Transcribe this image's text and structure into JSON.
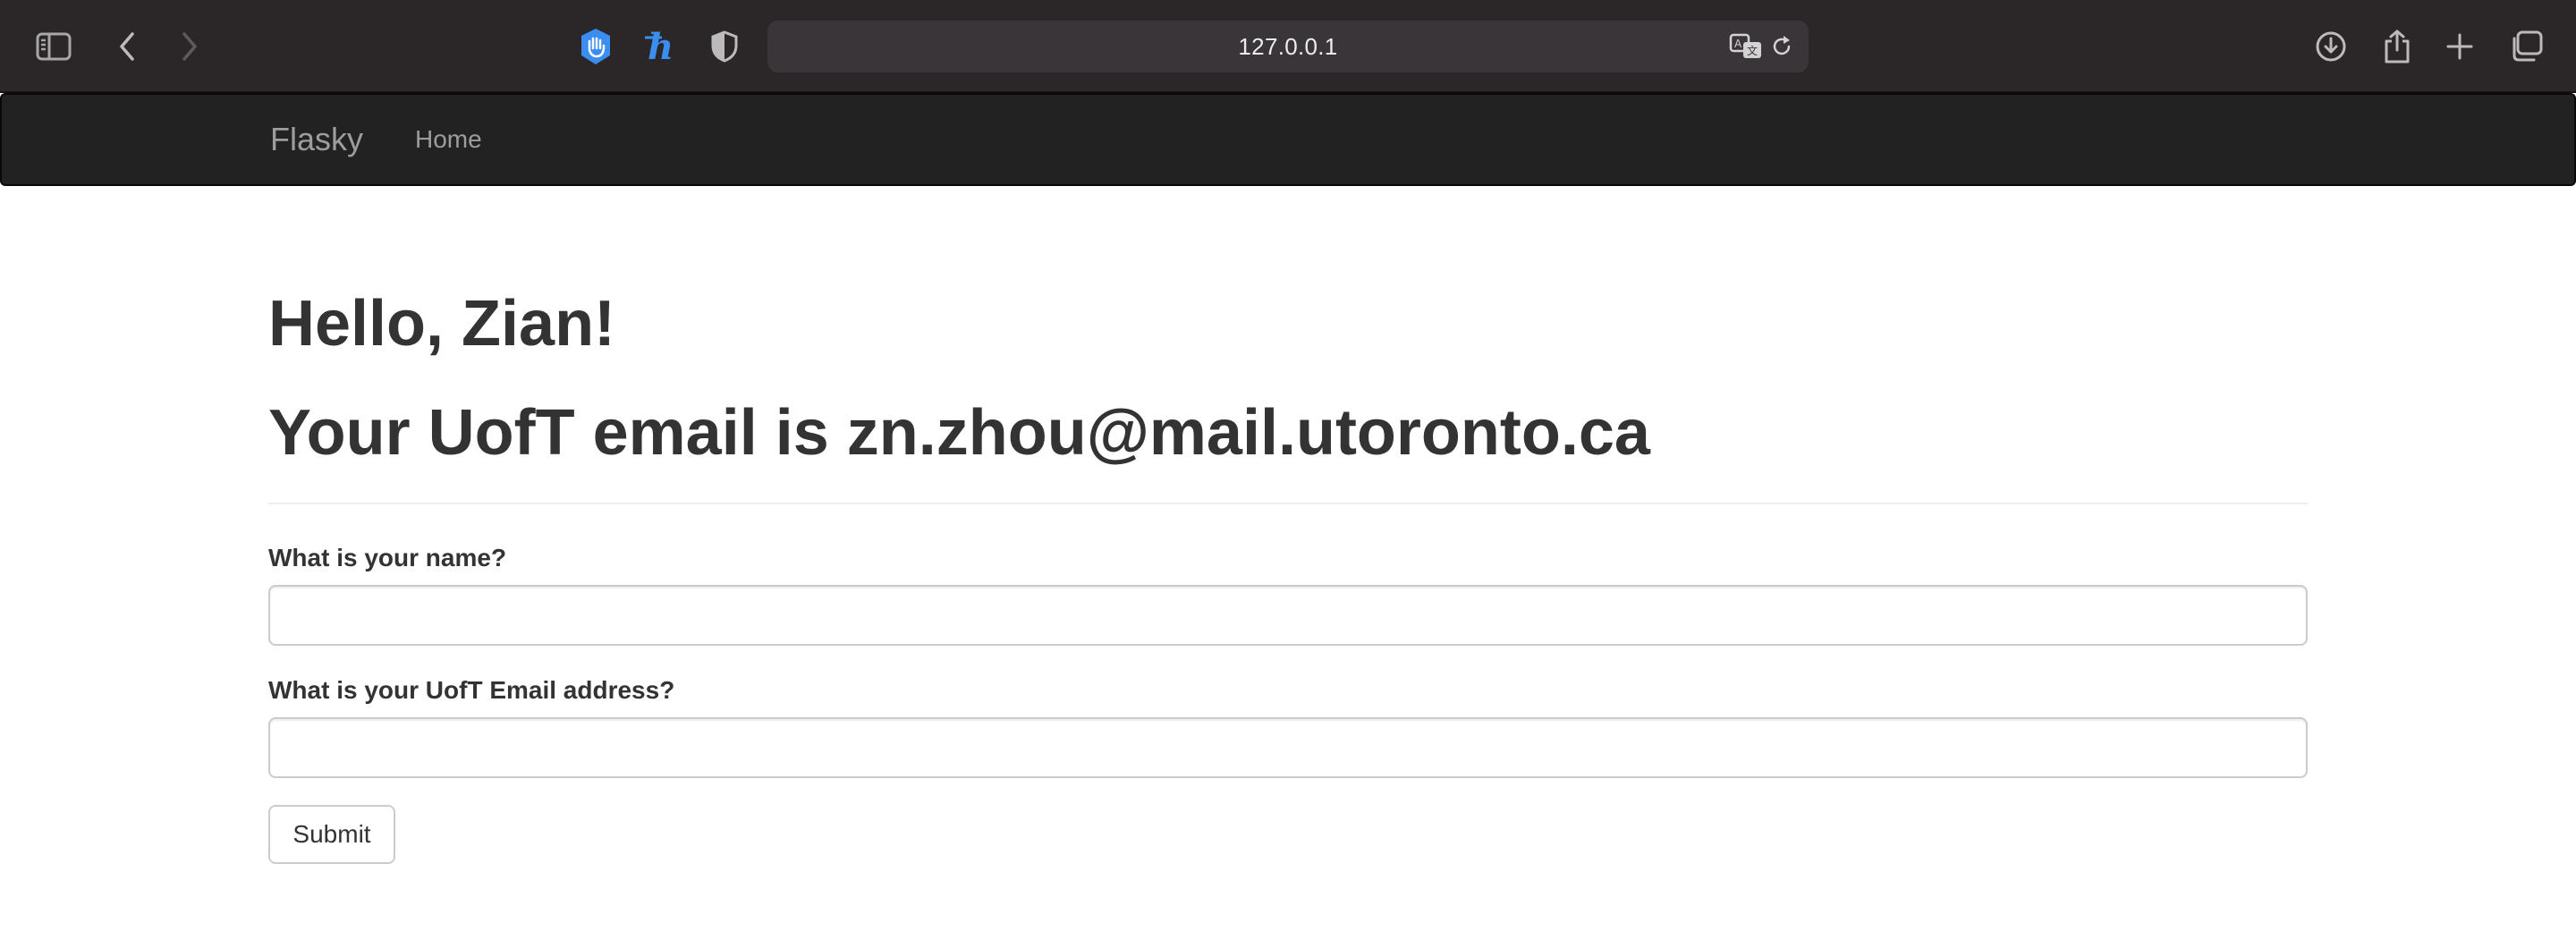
{
  "browser": {
    "url": "127.0.0.1",
    "icons": {
      "sidebar": "sidebar-toggle-icon",
      "back": "back-chevron-icon",
      "forward": "forward-chevron-icon",
      "privacy": "privacy-hand-icon",
      "extension": "h-extension-icon",
      "shield": "shield-icon",
      "translate": "translate-icon",
      "reload": "reload-icon",
      "download": "download-icon",
      "share": "share-icon",
      "new_tab": "plus-icon",
      "tabs": "tab-overview-icon"
    },
    "colors": {
      "toolbar_bg": "#2b2628",
      "urlbar_bg": "#3a3538",
      "accent_blue": "#3b8ef0"
    }
  },
  "navbar": {
    "brand": "Flasky",
    "links": [
      {
        "label": "Home"
      }
    ],
    "colors": {
      "bg": "#222222",
      "text": "#9d9d9d"
    }
  },
  "page": {
    "greeting": "Hello, Zian!",
    "email_line": "Your UofT email is zn.zhou@mail.utoronto.ca"
  },
  "form": {
    "name_label": "What is your name?",
    "name_value": "",
    "email_label": "What is your UofT Email address?",
    "email_value": "",
    "submit_label": "Submit"
  }
}
